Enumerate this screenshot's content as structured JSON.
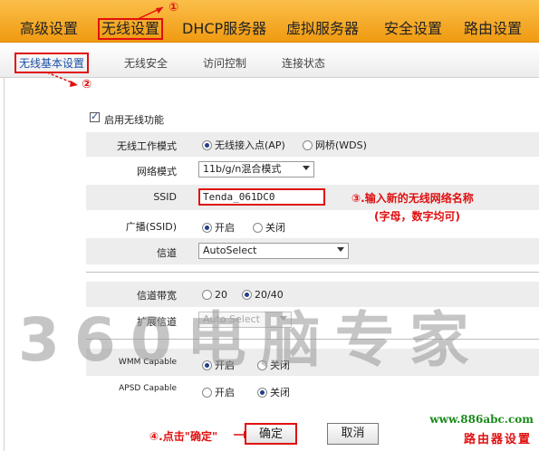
{
  "top_nav": [
    "高级设置",
    "无线设置",
    "DHCP服务器",
    "虚拟服务器",
    "安全设置",
    "路由设置"
  ],
  "sub_nav": [
    "无线基本设置",
    "无线安全",
    "访问控制",
    "连接状态"
  ],
  "markers": {
    "m1": "①",
    "m2": "②"
  },
  "form": {
    "enable_wireless": "启用无线功能",
    "mode_label": "无线工作模式",
    "mode_ap": "无线接入点(AP)",
    "mode_wds": "网桥(WDS)",
    "netmode_label": "网络模式",
    "netmode_value": "11b/g/n混合模式",
    "ssid_label": "SSID",
    "ssid_value": "Tenda_061DC0",
    "broadcast_label": "广播(SSID)",
    "on": "开启",
    "off": "关闭",
    "channel_label": "信道",
    "channel_value": "AutoSelect",
    "bandwidth_label": "信道带宽",
    "bw_20": "20",
    "bw_2040": "20/40",
    "ext_channel_label": "扩展信道",
    "ext_channel_value": "Auto Select",
    "wmm_label": "WMM Capable",
    "apsd_label": "APSD Capable",
    "ok_button": "确定",
    "cancel_button": "取消"
  },
  "annotations": {
    "ssid_note_line1": "③.输入新的无线网络名称",
    "ssid_note_line2": "(字母，数字均可)",
    "ok_note": "④.点击\"确定\""
  },
  "watermark": "360电脑专家",
  "site_url": "www.886abc.com",
  "site_name": "路由器设置"
}
